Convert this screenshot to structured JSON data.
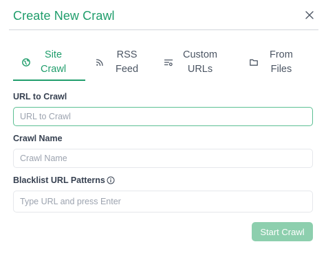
{
  "dialog": {
    "title": "Create New Crawl",
    "close_icon": "close-icon"
  },
  "tabs": [
    {
      "label": "Site\nCrawl",
      "icon": "globe-icon",
      "active": true
    },
    {
      "label": "RSS\nFeed",
      "icon": "rss-icon",
      "active": false
    },
    {
      "label": "Custom\nURLs",
      "icon": "list-settings-icon",
      "active": false
    },
    {
      "label": "From\nFiles",
      "icon": "folder-icon",
      "active": false
    }
  ],
  "form": {
    "url": {
      "label": "URL to Crawl",
      "placeholder": "URL to Crawl",
      "value": ""
    },
    "name": {
      "label": "Crawl Name",
      "placeholder": "Crawl Name",
      "value": ""
    },
    "blacklist": {
      "label": "Blacklist URL Patterns",
      "placeholder": "Type URL and press Enter",
      "info_icon": "info-icon"
    }
  },
  "submit_label": "Start Crawl",
  "colors": {
    "accent": "#1f9d6b",
    "button_disabled": "#8dcfae",
    "border": "#e5e7eb"
  }
}
